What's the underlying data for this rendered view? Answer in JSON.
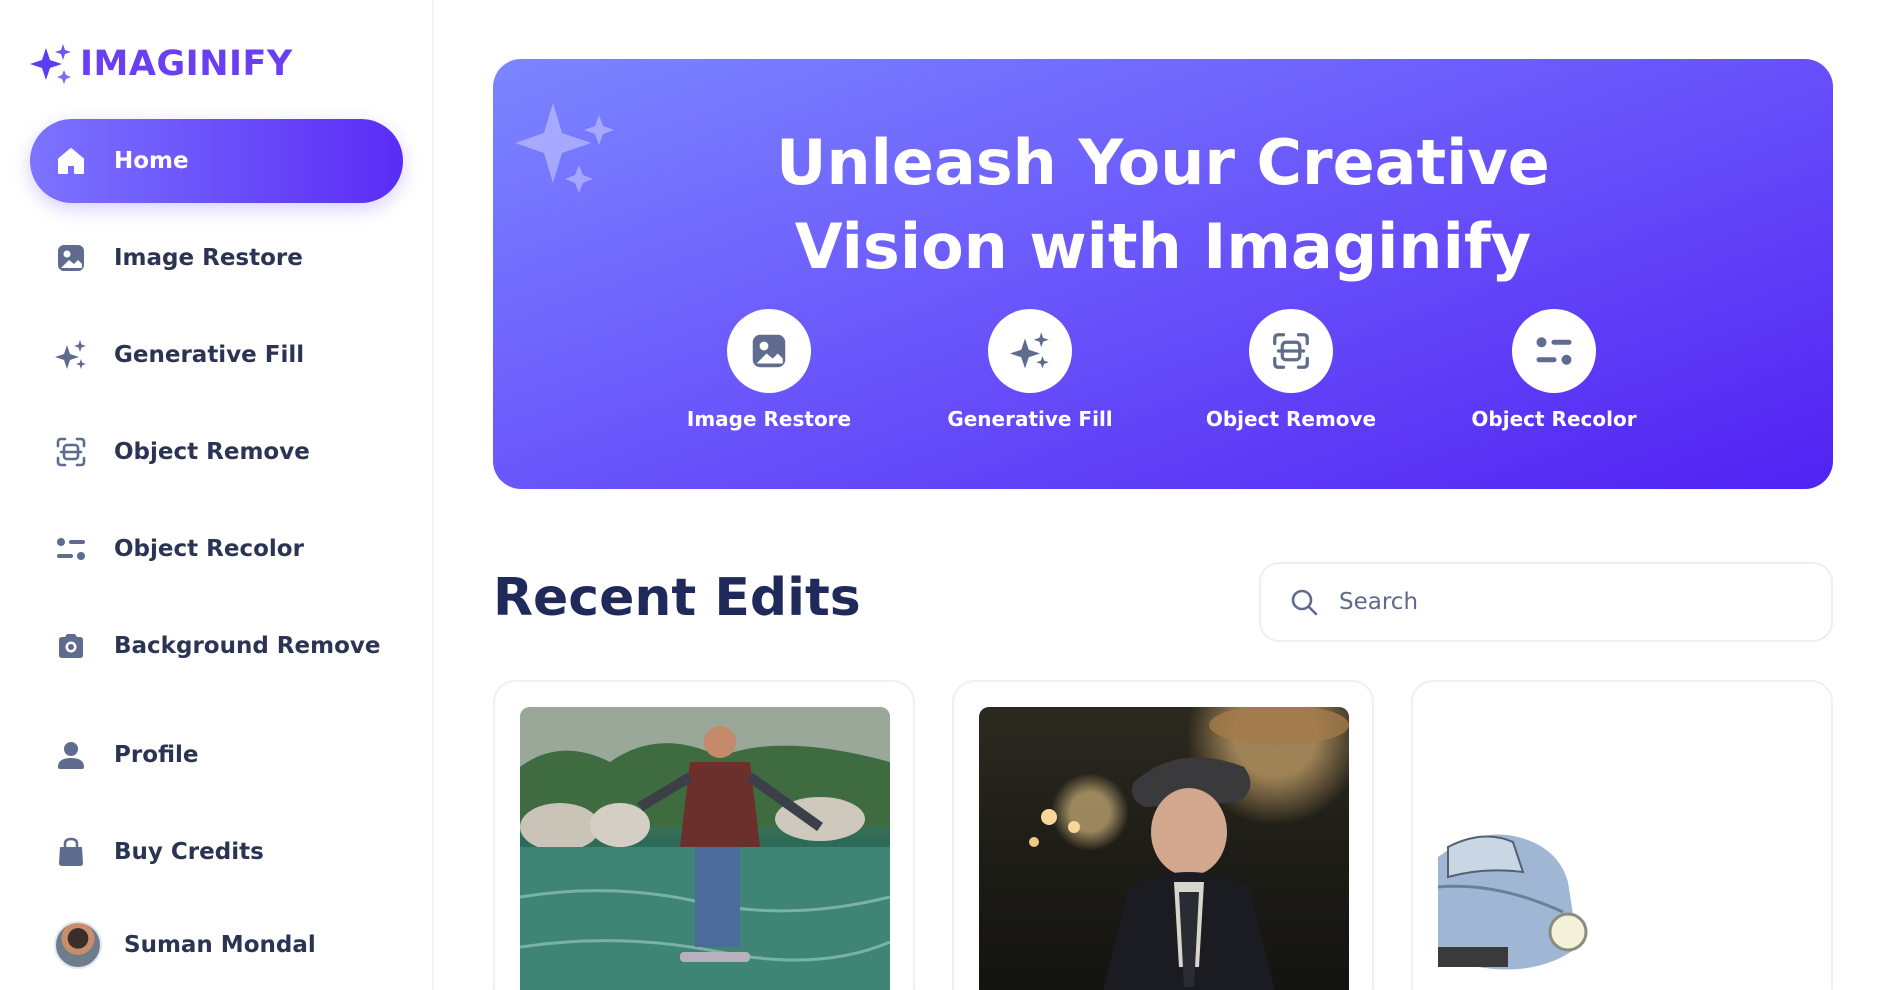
{
  "brand": {
    "name": "IMAGINIFY",
    "color": "#6a3ff2"
  },
  "sidebar": {
    "items": [
      {
        "label": "Home",
        "icon": "home-icon",
        "active": true
      },
      {
        "label": "Image Restore",
        "icon": "image-icon",
        "active": false
      },
      {
        "label": "Generative Fill",
        "icon": "sparkles-icon",
        "active": false
      },
      {
        "label": "Object Remove",
        "icon": "scan-icon",
        "active": false
      },
      {
        "label": "Object Recolor",
        "icon": "filter-icon",
        "active": false
      },
      {
        "label": "Background Remove",
        "icon": "camera-icon",
        "active": false
      },
      {
        "label": "Profile",
        "icon": "user-icon",
        "active": false
      },
      {
        "label": "Buy Credits",
        "icon": "bag-icon",
        "active": false
      }
    ],
    "user": {
      "name": "Suman Mondal"
    }
  },
  "hero": {
    "title_line1": "Unleash Your Creative",
    "title_line2": "Vision with Imaginify",
    "tools": [
      {
        "label": "Image Restore",
        "icon": "image-icon"
      },
      {
        "label": "Generative Fill",
        "icon": "sparkles-icon"
      },
      {
        "label": "Object Remove",
        "icon": "scan-icon"
      },
      {
        "label": "Object Recolor",
        "icon": "filter-icon"
      }
    ]
  },
  "recent": {
    "title": "Recent Edits",
    "search_placeholder": "Search"
  },
  "colors": {
    "accent": "#5a2cf5",
    "hero_start": "#7b86ff",
    "hero_end": "#5122f2",
    "text": "#2b3452",
    "heading": "#1f2a5a"
  }
}
